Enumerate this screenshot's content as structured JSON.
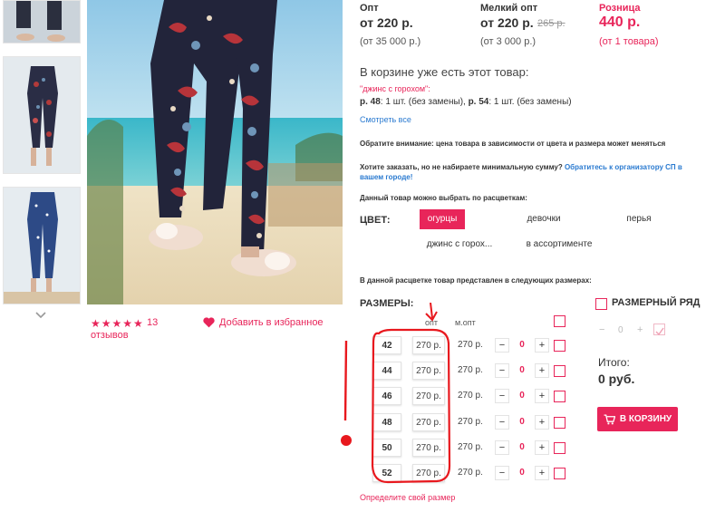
{
  "prices": {
    "opt": {
      "label": "Опт",
      "price": "от 220 р.",
      "min": "(от 35 000 р.)"
    },
    "small_opt": {
      "label": "Мелкий опт",
      "price": "от 220 р.",
      "old_price": "265 р.",
      "min": "(от 3 000 р.)"
    },
    "retail": {
      "label": "Розница",
      "price": "440 р.",
      "min": "(от 1 товара)"
    }
  },
  "cart_notice": {
    "title": "В корзине уже есть этот товар:",
    "item_name": "\"джинс с горохом\":",
    "line_a_bold": "р. 48",
    "line_a_rest": ": 1 шт. (без замены), ",
    "line_b_bold": "р. 54",
    "line_b_rest": ": 1 шт. (без замены)",
    "see_all": "Смотреть все"
  },
  "notes": {
    "price_note": "Обратите внимание: цена товара в зависимости от цвета и размера может меняться",
    "min_sum_q": "Хотите заказать, но не набираете минимальную сумму?",
    "min_sum_link": "Обратитесь к организатору СП в вашем городе!",
    "colors_intro": "Данный товар можно выбрать по расцветкам:",
    "sizes_intro": "В данной расцветке товар представлен в следующих размерах:"
  },
  "colors": {
    "label": "ЦВЕТ:",
    "options": [
      "огурцы",
      "девочки",
      "перья",
      "джинс с горох...",
      "в ассортименте"
    ],
    "active_color": "#e8255a"
  },
  "sizes": {
    "label": "РАЗМЕРЫ:",
    "col_opt": "опт",
    "col_mopt": "м.опт",
    "rows": [
      {
        "size": "42",
        "opt": "270 р.",
        "mopt": "270 р.",
        "qty": "0"
      },
      {
        "size": "44",
        "opt": "270 р.",
        "mopt": "270 р.",
        "qty": "0"
      },
      {
        "size": "46",
        "opt": "270 р.",
        "mopt": "270 р.",
        "qty": "0"
      },
      {
        "size": "48",
        "opt": "270 р.",
        "mopt": "270 р.",
        "qty": "0"
      },
      {
        "size": "50",
        "opt": "270 р.",
        "mopt": "270 р.",
        "qty": "0"
      },
      {
        "size": "52",
        "opt": "270 р.",
        "mopt": "270 р.",
        "qty": "0"
      }
    ],
    "minus": "−",
    "plus": "+",
    "define_link": "Определите свой размер"
  },
  "size_row": {
    "label": "РАЗМЕРНЫЙ РЯД",
    "minus": "−",
    "qty": "0",
    "plus": "+"
  },
  "total": {
    "label": "Итого:",
    "value": "0 руб."
  },
  "cart_button": {
    "label": "В КОРЗИНУ"
  },
  "rating": {
    "stars": 5,
    "count": "13",
    "reviews": "отзывов"
  },
  "favorite": {
    "label": "Добавить в избранное"
  },
  "accent": "#e8255a"
}
